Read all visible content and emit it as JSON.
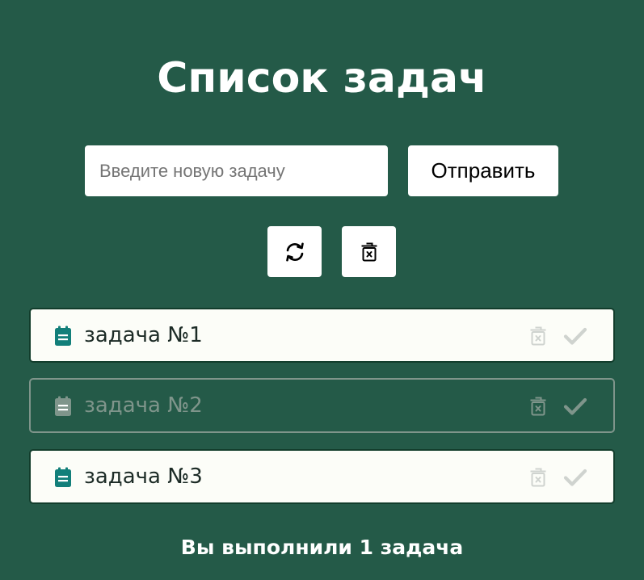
{
  "title": "Список задач",
  "input": {
    "placeholder": "Введите новую задачу",
    "value": ""
  },
  "send_button_label": "Отправить",
  "toolbar": {
    "refresh_icon": "refresh-icon",
    "clear_all_icon": "trash-x-icon"
  },
  "tasks": [
    {
      "text": "задача №1",
      "completed": false,
      "icon": "clipboard-icon"
    },
    {
      "text": "задача №2",
      "completed": true,
      "icon": "clipboard-icon"
    },
    {
      "text": "задача №3",
      "completed": false,
      "icon": "clipboard-icon"
    }
  ],
  "summary": "Вы выполнили 1 задача",
  "colors": {
    "background": "#245a48",
    "task_icon_active": "#127f7a",
    "task_icon_done": "#7f958b",
    "action_icon_inactive": "#cfd3cf",
    "action_icon_done": "#7f958b"
  }
}
